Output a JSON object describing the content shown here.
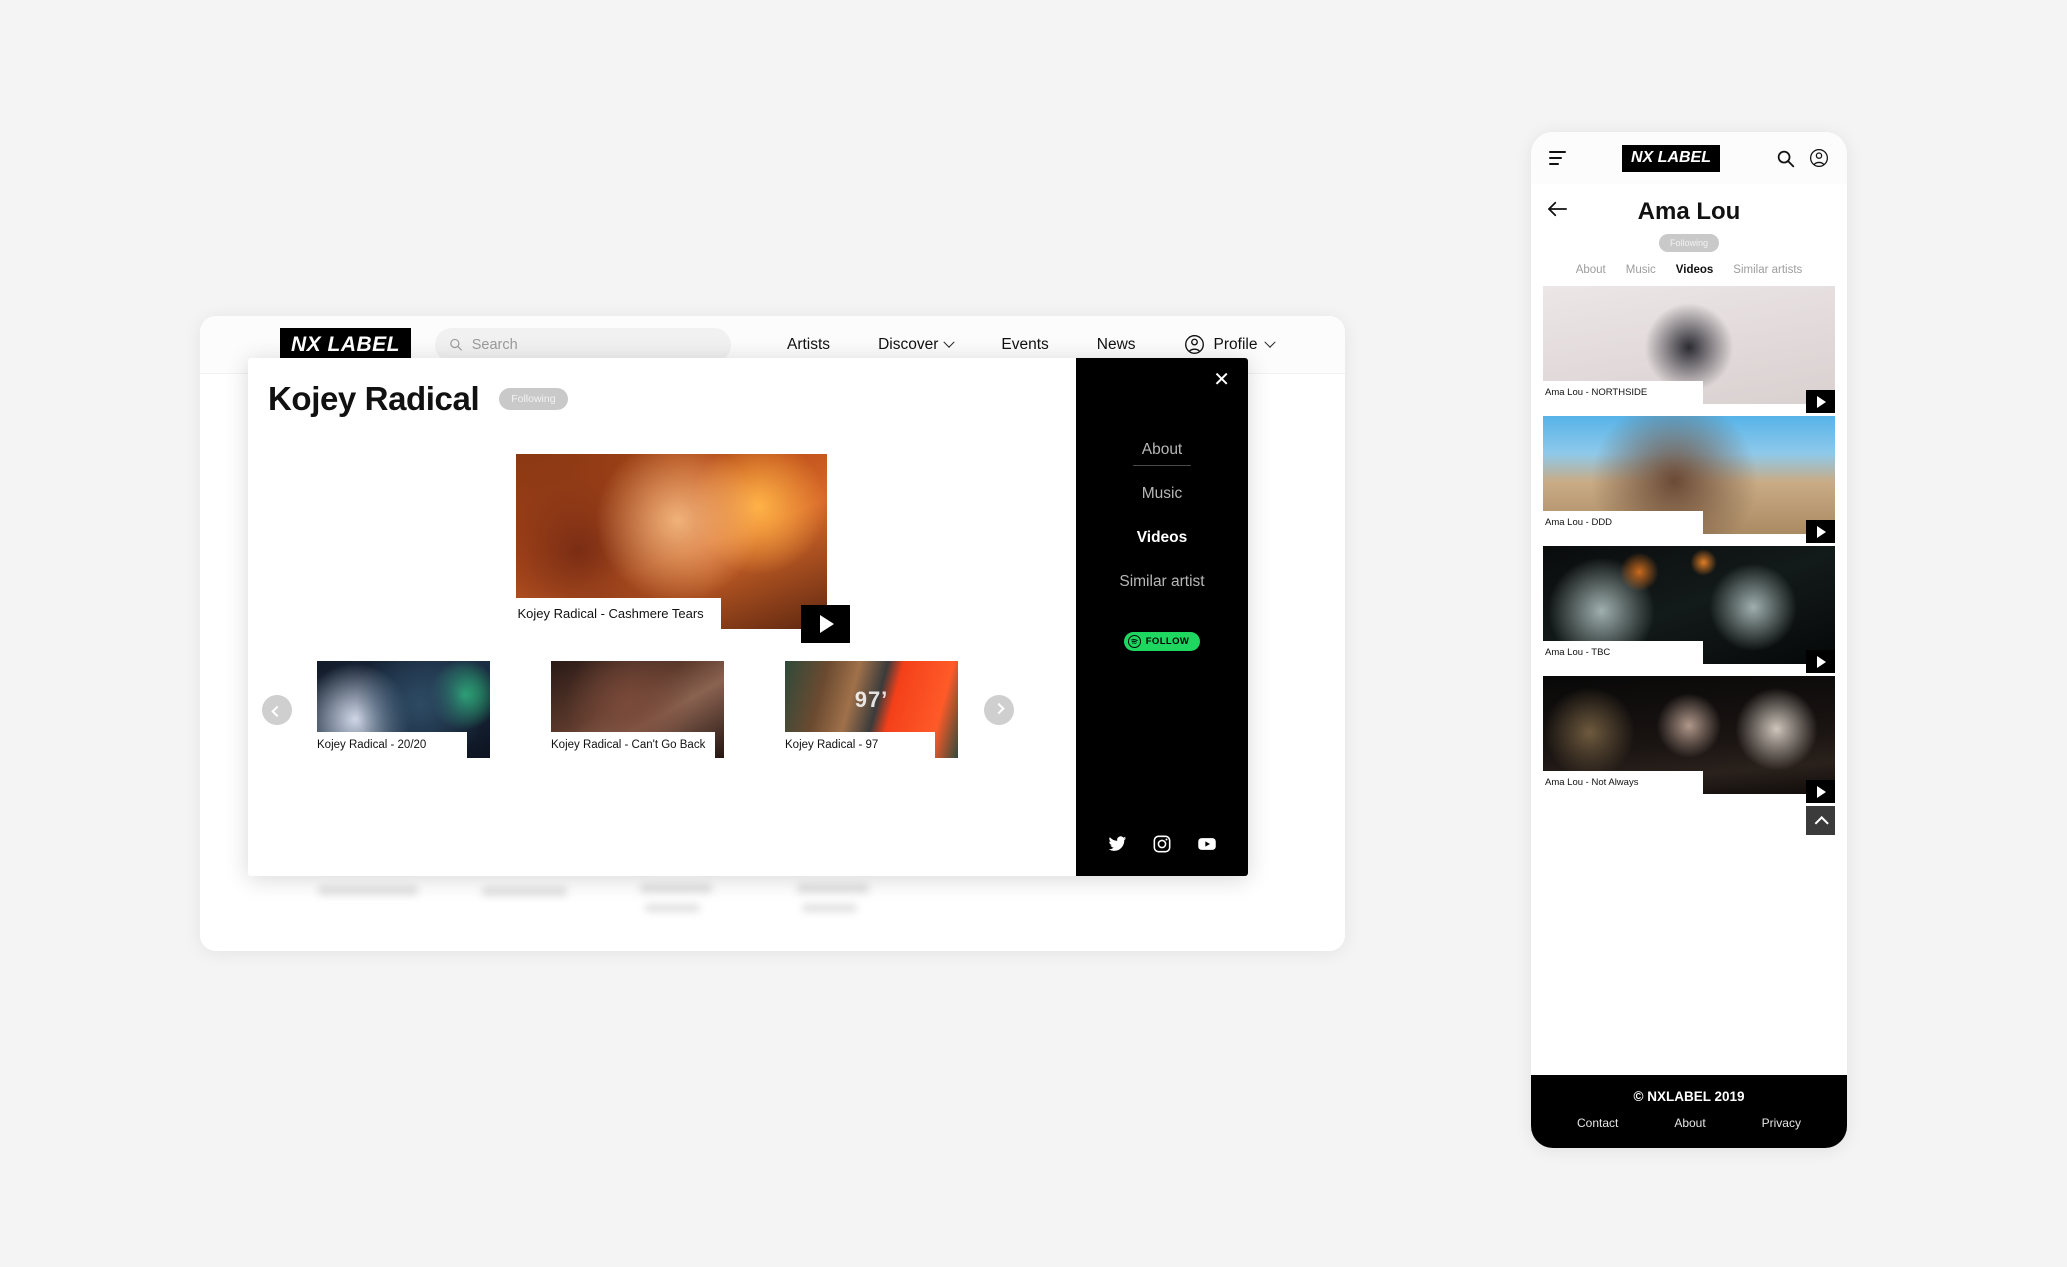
{
  "desktop": {
    "brand": "NX LABEL",
    "search": {
      "placeholder": "Search",
      "value": "",
      "icon": "search-icon"
    },
    "nav": [
      {
        "label": "Artists",
        "has_caret": false
      },
      {
        "label": "Discover",
        "has_caret": true
      },
      {
        "label": "Events",
        "has_caret": false
      },
      {
        "label": "News",
        "has_caret": false
      },
      {
        "label": "Profile",
        "has_caret": true
      }
    ],
    "modal": {
      "artist_name": "Kojey Radical",
      "following_badge": "Following",
      "close_label": "✕",
      "featured_video": {
        "caption": "Kojey Radical - Cashmere Tears",
        "play_icon": "play-icon"
      },
      "carousel": {
        "prev_label": "‹",
        "next_label": "›",
        "items": [
          {
            "caption": "Kojey Radical - 20/20"
          },
          {
            "caption": "Kojey Radical - Can't Go Back"
          },
          {
            "caption": "Kojey Radical - 97",
            "overlay_text": "97’"
          }
        ]
      },
      "panel": {
        "items": [
          {
            "label": "About",
            "active": false
          },
          {
            "label": "Music",
            "active": false
          },
          {
            "label": "Videos",
            "active": true
          },
          {
            "label": "Similar artist",
            "active": false
          }
        ],
        "follow_button": "FOLLOW",
        "follow_accent": "#1ed760",
        "socials": [
          {
            "name": "twitter-icon"
          },
          {
            "name": "instagram-icon"
          },
          {
            "name": "youtube-icon"
          }
        ]
      }
    }
  },
  "mobile": {
    "brand": "NX LABEL",
    "menu_icon": "hamburger-icon",
    "search_icon": "search-icon",
    "account_icon": "account-icon",
    "back_icon": "back-arrow-icon",
    "artist_name": "Ama Lou",
    "following_badge": "Following",
    "tabs": [
      {
        "label": "About",
        "active": false
      },
      {
        "label": "Music",
        "active": false
      },
      {
        "label": "Videos",
        "active": true
      },
      {
        "label": "Similar artists",
        "active": false
      }
    ],
    "videos": [
      {
        "caption": "Ama Lou - NORTHSIDE"
      },
      {
        "caption": "Ama Lou - DDD"
      },
      {
        "caption": "Ama Lou - TBC"
      },
      {
        "caption": "Ama Lou - Not Always"
      }
    ],
    "scroll_top_icon": "chevron-up-icon",
    "footer": {
      "copyright": "© NXLABEL 2019",
      "links": [
        {
          "label": "Contact"
        },
        {
          "label": "About"
        },
        {
          "label": "Privacy"
        }
      ]
    }
  }
}
